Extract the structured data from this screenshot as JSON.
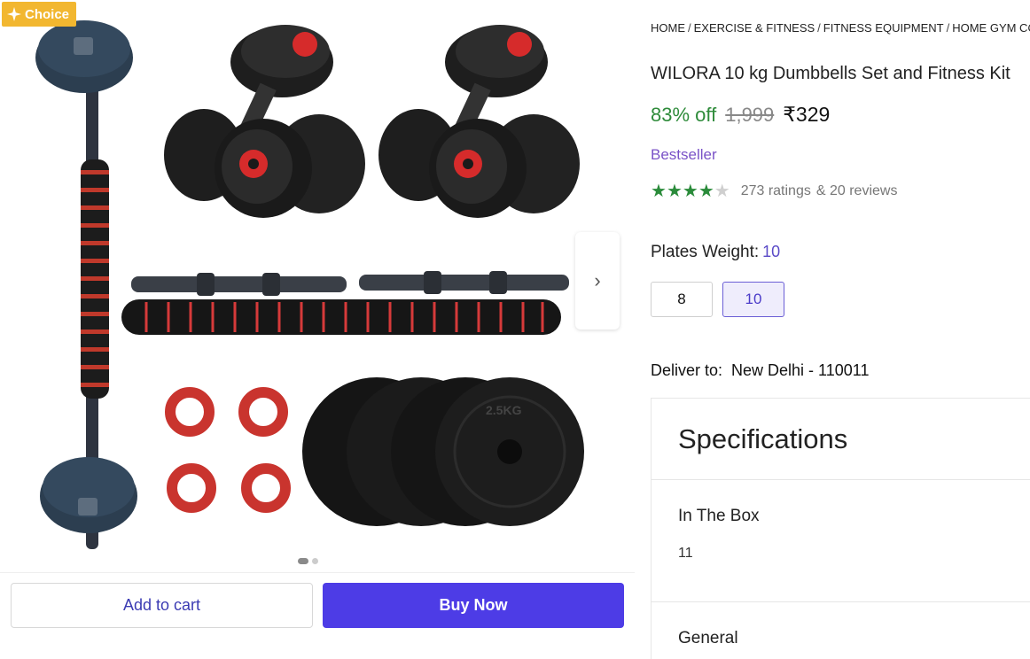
{
  "badge": {
    "label": "Choice",
    "color": "#f2b730"
  },
  "gallery": {
    "next_icon": "chevron-right-icon",
    "image_alt": "WILORA dumbbells set product image",
    "plate_text": "2.5KG"
  },
  "actions": {
    "add_to_cart": "Add to cart",
    "buy_now": "Buy Now",
    "buy_color": "#4d3ce6"
  },
  "breadcrumb": [
    "HOME",
    "EXERCISE & FITNESS",
    "FITNESS EQUIPMENT",
    "HOME GYM COM"
  ],
  "product": {
    "title": "WILORA 10 kg Dumbbells Set and Fitness Kit",
    "discount": "83% off",
    "mrp": "1,999",
    "price": "₹329",
    "bestseller": "Bestseller",
    "rating": 4,
    "rating_max": 5,
    "ratings_text": "273 ratings",
    "reviews_text": "& 20 reviews"
  },
  "plates": {
    "label": "Plates Weight:",
    "selected": "10",
    "options": [
      "8",
      "10"
    ]
  },
  "delivery": {
    "label": "Deliver to:",
    "location": "New Delhi - 110011"
  },
  "specs": {
    "heading": "Specifications",
    "in_the_box": {
      "title": "In The Box",
      "value": "11"
    },
    "general": "General"
  },
  "colors": {
    "discount": "#2e8b3a",
    "accent": "#7a52c7",
    "star": "#2a8b3a"
  }
}
